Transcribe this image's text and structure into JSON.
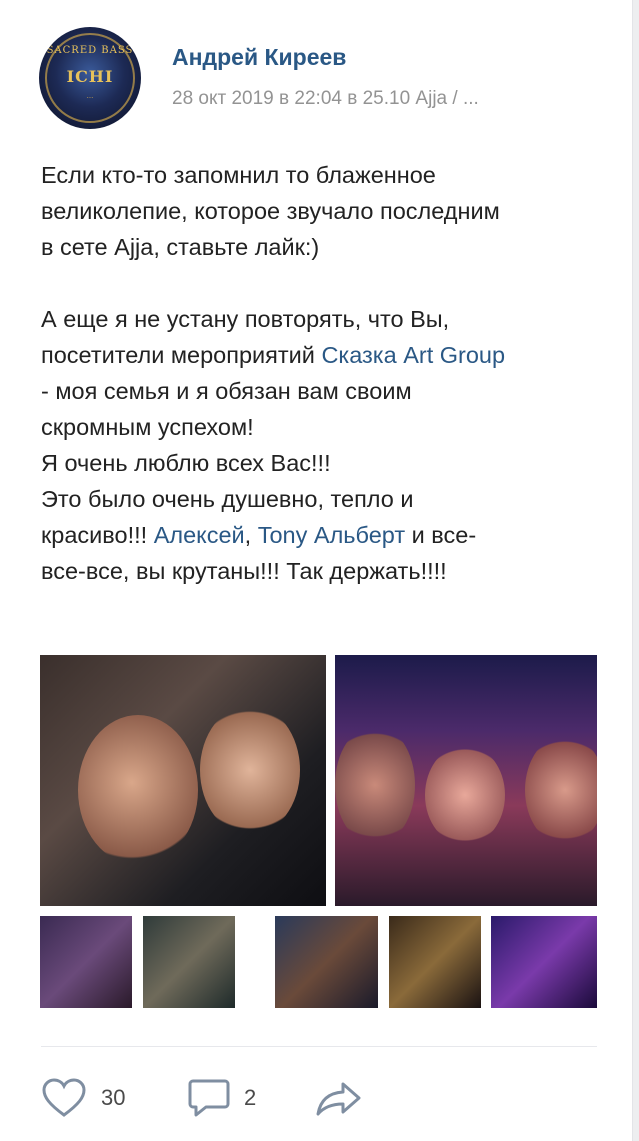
{
  "post": {
    "author": "Андрей Киреев",
    "meta": "28 окт 2019 в 22:04 в 25.10 Ajja / ...",
    "avatar_text": {
      "arc": "SACRED BASS",
      "mark": "ICHI",
      "sub": "..."
    },
    "text": {
      "l1": "Если кто-то запомнил то блаженное",
      "l2": "великолепие, которое звучало последним",
      "l3": "в сете Ajja, ставьте лайк:)",
      "l5": "А еще я не устану повторять, что Вы,",
      "l6a": "посетители мероприятий ",
      "l6_link": "Сказка Art Group",
      "l7": "- моя семья и я обязан вам своим",
      "l8": "скромным успехом!",
      "l9": "Я очень люблю всех Вас!!!",
      "l10": "Это было очень душевно, тепло и",
      "l11a": "красиво!!! ",
      "l11_link1": "Алексей",
      "l11b": ", ",
      "l11_link2": "Tony Альберт",
      "l11c": " и все-",
      "l12": "все-все, вы крутаны!!! Так держать!!!!"
    }
  },
  "actions": {
    "likes": "30",
    "comments": "2",
    "icons": [
      "heart-icon",
      "comment-icon",
      "share-icon"
    ]
  },
  "colors": {
    "link": "#2a5885",
    "meta": "#939393",
    "text": "#222222"
  }
}
